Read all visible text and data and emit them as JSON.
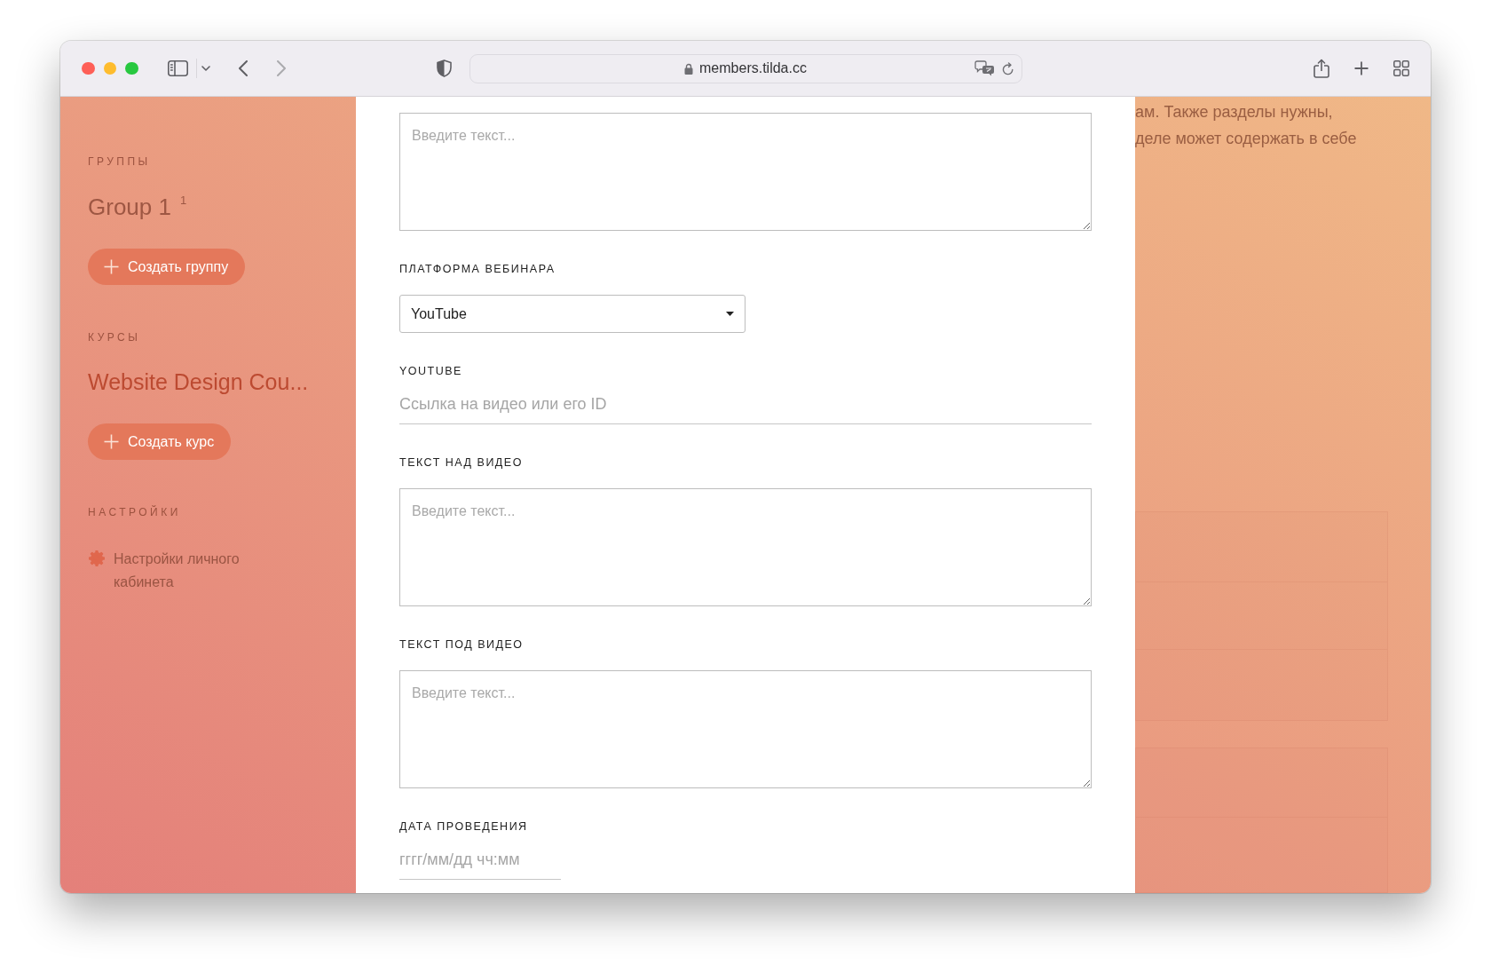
{
  "browser": {
    "address": "members.tilda.cc",
    "can_go_forward": false
  },
  "sidebar": {
    "groups": {
      "heading": "ГРУППЫ",
      "items": [
        {
          "name": "Group 1",
          "count": "1"
        }
      ],
      "button": "Создать группу"
    },
    "courses": {
      "heading": "КУРСЫ",
      "items": [
        {
          "name": "Website Design Cou..."
        }
      ],
      "button": "Создать курс"
    },
    "settings": {
      "heading": "НАСТРОЙКИ",
      "links": [
        {
          "label": "Настройки личного кабинета"
        }
      ]
    }
  },
  "form": {
    "fields": [
      {
        "kind": "textarea",
        "placeholder": "Введите текст..."
      },
      {
        "kind": "select",
        "label": "ПЛАТФОРМА ВЕБИНАРА",
        "value": "YouTube"
      },
      {
        "kind": "line",
        "label": "YOUTUBE",
        "placeholder": "Ссылка на видео или его ID"
      },
      {
        "kind": "textarea",
        "label": "ТЕКСТ НАД ВИДЕО",
        "placeholder": "Введите текст..."
      },
      {
        "kind": "textarea",
        "label": "ТЕКСТ ПОД ВИДЕО",
        "placeholder": "Введите текст..."
      },
      {
        "kind": "date",
        "label": "ДАТА ПРОВЕДЕНИЯ",
        "placeholder": "гггг/мм/дд чч:мм"
      }
    ]
  },
  "background_page": {
    "text_lines": [
      "ам. Также разделы нужны,",
      "деле может содержать в себе"
    ]
  }
}
